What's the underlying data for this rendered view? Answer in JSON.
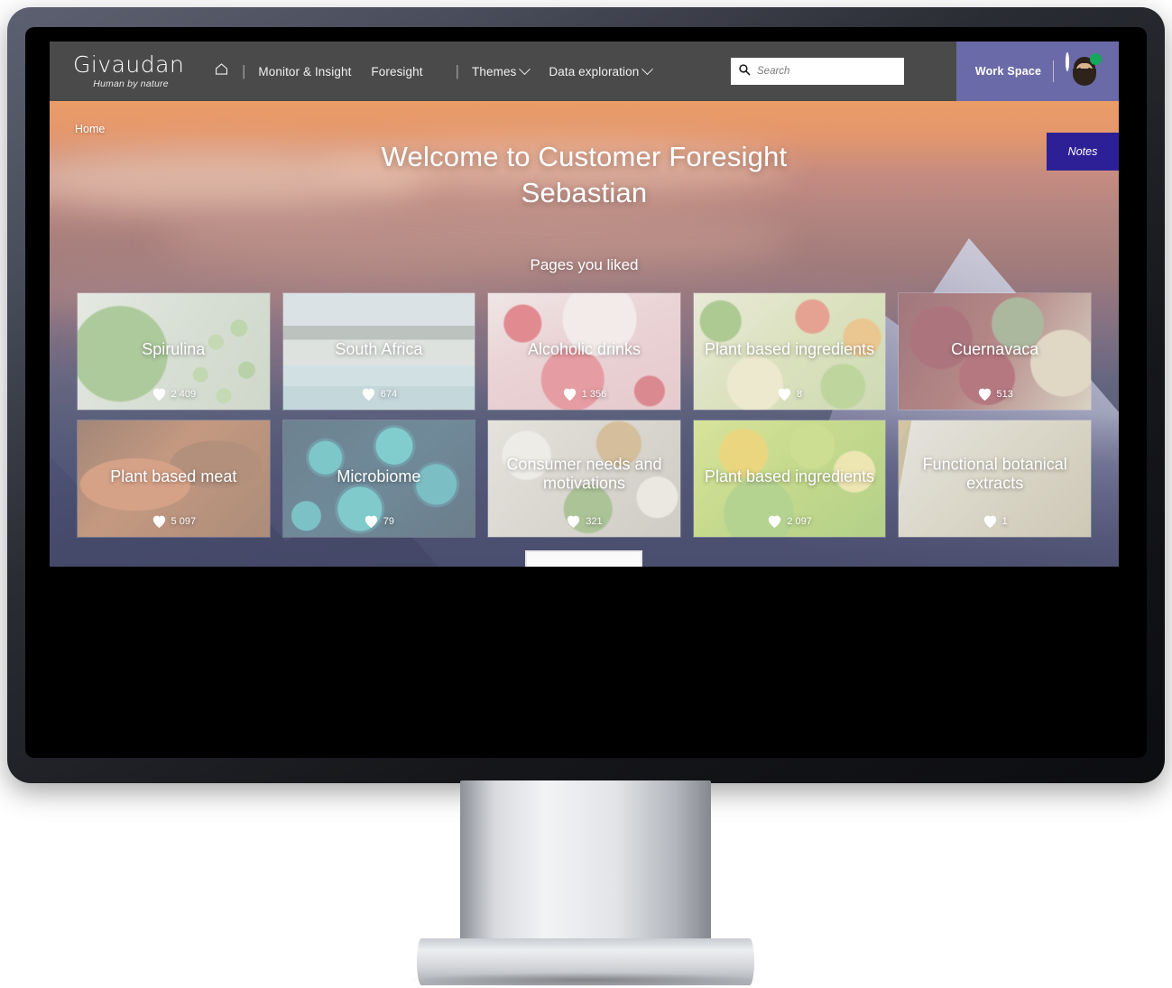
{
  "topbar": {
    "brand_name": "Givaudan",
    "brand_tagline": "Human by nature",
    "home_icon": "home-icon",
    "nav_items": [
      {
        "label": "Monitor & Insight",
        "has_caret": false
      },
      {
        "label": "Foresight",
        "has_caret": false
      },
      {
        "label": "Themes",
        "has_caret": true
      },
      {
        "label": "Data exploration",
        "has_caret": true
      }
    ],
    "search": {
      "icon": "search-icon",
      "value": "",
      "placeholder": "Search"
    },
    "workspace_label": "Work Space",
    "avatar": "user-avatar",
    "status": "online",
    "bg_color": "#4a4a4a",
    "workspace_bg_color": "#6b6aa8"
  },
  "hero": {
    "breadcrumb": "Home",
    "notes_button_label": "Notes",
    "notes_button_color": "#2d2096",
    "welcome_line_1": "Welcome to Customer Foresight",
    "welcome_line_2": "Sebastian",
    "pages_liked_heading": "Pages you liked"
  },
  "cards": [
    {
      "title": "Spirulina",
      "likes": "2 409",
      "photo_class": "photo-spirulina",
      "name": "card-spirulina"
    },
    {
      "title": "South Africa",
      "likes": "674",
      "photo_class": "photo-southafrica",
      "name": "card-south-africa"
    },
    {
      "title": "Alcoholic drinks",
      "likes": "1 356",
      "photo_class": "photo-alcoholic",
      "name": "card-alcoholic-drinks"
    },
    {
      "title": "Plant based ingredients",
      "likes": "8",
      "photo_class": "photo-plantingredients-1",
      "name": "card-plant-based-ingredients-1"
    },
    {
      "title": "Cuernavaca",
      "likes": "513",
      "photo_class": "photo-cuernavaca",
      "name": "card-cuernavaca"
    },
    {
      "title": "Plant based meat",
      "likes": "5 097",
      "photo_class": "photo-plantmeat",
      "name": "card-plant-based-meat"
    },
    {
      "title": "Microbiome",
      "likes": "79",
      "photo_class": "photo-microbiome",
      "name": "card-microbiome"
    },
    {
      "title": "Consumer needs and motivations",
      "likes": "321",
      "photo_class": "photo-consumer",
      "name": "card-consumer-needs"
    },
    {
      "title": "Plant based ingredients",
      "likes": "2 097",
      "photo_class": "photo-plantingredients-2",
      "name": "card-plant-based-ingredients-2"
    },
    {
      "title": "Functional botanical extracts",
      "likes": "1",
      "photo_class": "photo-botanical",
      "name": "card-functional-botanical-extracts"
    }
  ]
}
